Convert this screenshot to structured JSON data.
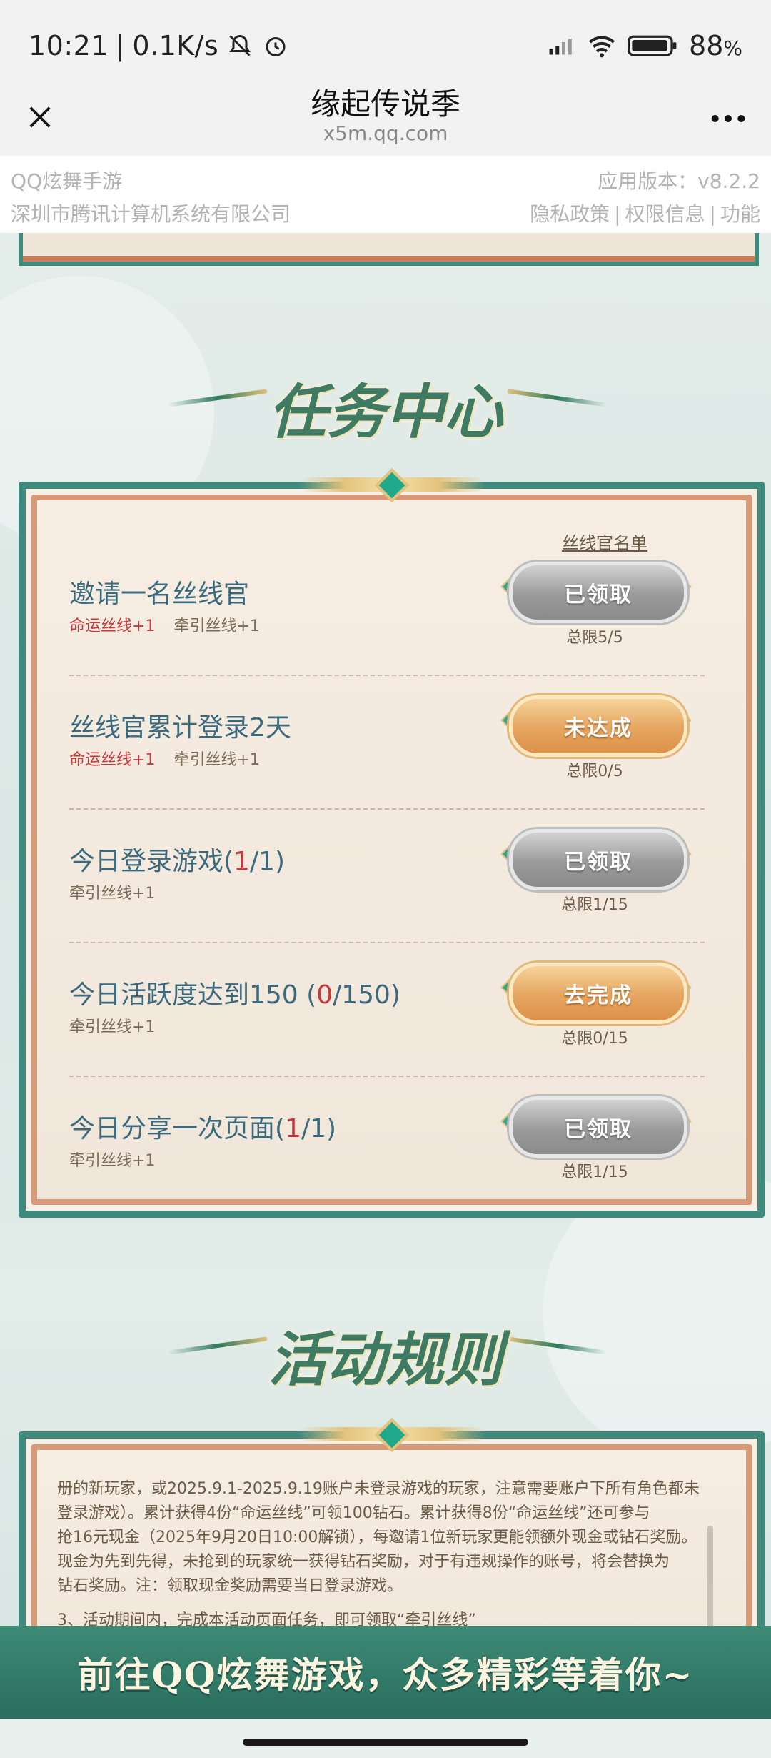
{
  "status_bar": {
    "time": "10:21",
    "speed": "0.1K/s",
    "battery": "88",
    "battery_unit": "%",
    "icons": [
      "bell-off-icon",
      "alarm-icon",
      "signal-icon",
      "wifi-icon",
      "battery-icon"
    ]
  },
  "title_bar": {
    "title": "缘起传说季",
    "url": "x5m.qq.com",
    "close_icon": "close-icon",
    "more_icon": "more-icon"
  },
  "info_bar": {
    "app_name": "QQ炫舞手游",
    "version": "应用版本：v8.2.2",
    "company": "深圳市腾讯计算机系统有限公司",
    "links": [
      "隐私政策",
      "权限信息",
      "功能"
    ]
  },
  "task_center": {
    "title": "任务中心",
    "names_link": "丝线官名单",
    "tasks": [
      {
        "title": "邀请一名丝线官",
        "rewards": [
          "命运丝线+1",
          "牵引丝线+1"
        ],
        "button": "已领取",
        "limit": "总限5/5"
      },
      {
        "title": "丝线官累计登录2天",
        "rewards": [
          "命运丝线+1",
          "牵引丝线+1"
        ],
        "button": "未达成",
        "limit": "总限0/5"
      },
      {
        "title_pre": "今日登录游戏(",
        "title_hl": "1",
        "title_post": "/1)",
        "rewards": [
          "牵引丝线+1"
        ],
        "button": "已领取",
        "limit": "总限1/15"
      },
      {
        "title_pre": "今日活跃度达到150 (",
        "title_hl": "0",
        "title_post": "/150)",
        "rewards": [
          "牵引丝线+1"
        ],
        "button": "去完成",
        "limit": "总限0/15"
      },
      {
        "title_pre": "今日分享一次页面(",
        "title_hl": "1",
        "title_post": "/1)",
        "rewards": [
          "牵引丝线+1"
        ],
        "button": "已领取",
        "limit": "总限1/15"
      }
    ]
  },
  "rules": {
    "title": "活动规则",
    "text_lines": [
      "册的新玩家，或2025.9.1-2025.9.19账户未登录游戏的玩家，注意需要账户下所有角色都未",
      "登录游戏）。累计获得4份“命运丝线”可领100钻石。累计获得8份“命运丝线”还可参与",
      "抢16元现金（2025年9月20日10:00解锁），每邀请1位新玩家更能领额外现金或钻石奖励。",
      "现金为先到先得，未抢到的玩家统一获得钻石奖励，对于有违规操作的账号，将会替换为",
      "钻石奖励。注：领取现金奖励需要当日登录游戏。",
      "3、活动期间内，完成本活动页面任务，即可领取“牵引丝线”"
    ]
  },
  "cta": {
    "label": "前往QQ炫舞游戏，众多精彩等着你~"
  },
  "colors": {
    "frame_teal": "#3f8a7c",
    "title_green": "#3f7a62",
    "highlight_red": "#c9383a",
    "button_gold": "#e5a560",
    "button_gray": "#9a9a9a"
  }
}
